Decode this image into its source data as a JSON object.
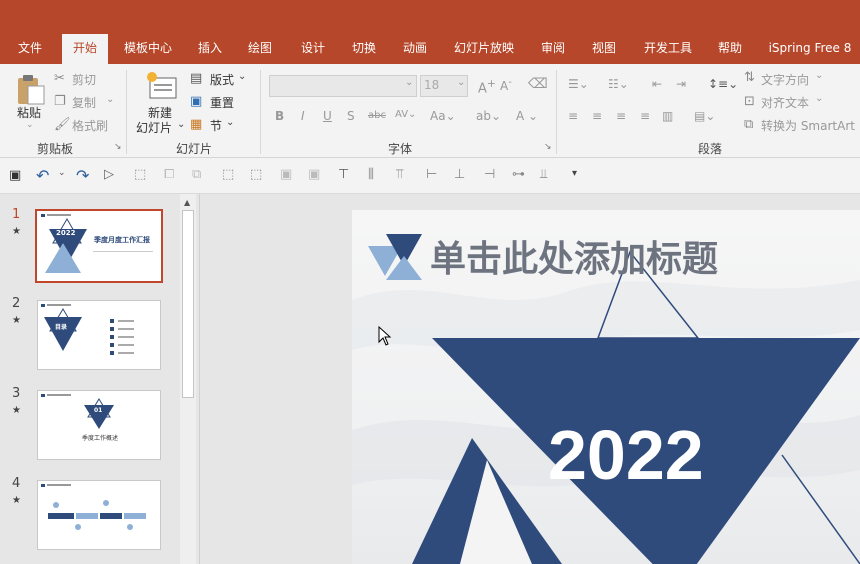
{
  "tabs": [
    "文件",
    "开始",
    "模板中心",
    "插入",
    "绘图",
    "设计",
    "切换",
    "动画",
    "幻灯片放映",
    "审阅",
    "视图",
    "开发工具",
    "帮助",
    "iSpring Free 8"
  ],
  "clipboard": {
    "paste": "粘贴",
    "cut": "剪切",
    "copy": "复制",
    "format_painter": "格式刷",
    "group": "剪贴板"
  },
  "slides_group": {
    "new_slide": "新建",
    "new_slide2": "幻灯片",
    "layout": "版式",
    "reset": "重置",
    "section": "节",
    "group": "幻灯片"
  },
  "font": {
    "size": "18",
    "group": "字体"
  },
  "paragraph": {
    "text_direction": "文字方向",
    "align_text": "对齐文本",
    "smartart": "转换为 SmartArt",
    "group": "段落"
  },
  "thumbnails": [
    {
      "num": "1",
      "star": "★",
      "title": "季度月度工作汇报",
      "year": "2022"
    },
    {
      "num": "2",
      "star": "★",
      "label": "目录"
    },
    {
      "num": "3",
      "star": "★",
      "label": "01",
      "caption": "季度工作概述"
    },
    {
      "num": "4",
      "star": "★"
    }
  ],
  "slide": {
    "title": "单击此处添加标题",
    "year": "2022"
  },
  "colors": {
    "accent": "#b7472a",
    "navy": "#2f4b7c",
    "light_blue": "#8fb0d6"
  }
}
